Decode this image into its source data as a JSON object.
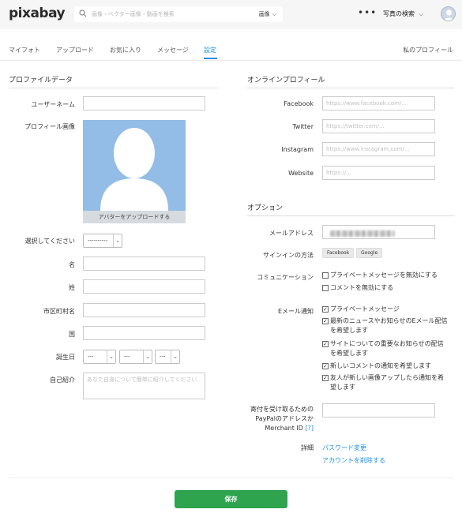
{
  "header": {
    "logo": "pixabay",
    "search_placeholder": "画像・ベクター画像・動画を検索",
    "search_type": "画像",
    "more": "•••",
    "explore": "写真の検索"
  },
  "tabs": {
    "items": [
      "マイフォト",
      "アップロード",
      "お気に入り",
      "メッセージ",
      "設定"
    ],
    "active": "設定",
    "my_profile": "私のプロフィール"
  },
  "profile": {
    "section_title": "プロファイルデータ",
    "username_label": "ユーザーネーム",
    "username_value": "",
    "image_label": "プロフィール画像",
    "upload_label": "アバターをアップロードする",
    "select_label": "選択してください",
    "select_value": "----------",
    "first_name_label": "名",
    "last_name_label": "姓",
    "city_label": "市区町村名",
    "country_label": "国",
    "birthday_label": "誕生日",
    "birthday_day": "---",
    "birthday_month": "---",
    "birthday_year": "---",
    "bio_label": "自己紹介",
    "bio_placeholder": "あなた自身について簡単に紹介してください"
  },
  "online": {
    "section_title": "オンラインプロフィール",
    "facebook_label": "Facebook",
    "facebook_placeholder": "https://www.facebook.com/...",
    "twitter_label": "Twitter",
    "twitter_placeholder": "https://twitter.com/...",
    "instagram_label": "Instagram",
    "instagram_placeholder": "https://www.instagram.com/...",
    "website_label": "Website",
    "website_placeholder": "https://..."
  },
  "options": {
    "section_title": "オプション",
    "email_label": "メールアドレス",
    "signin_label": "サインインの方法",
    "signin_methods": [
      "Facebook",
      "Google"
    ],
    "communication_label": "コミュニケーション",
    "communication_options": [
      {
        "label": "プライベートメッセージを無効にする",
        "checked": false
      },
      {
        "label": "コメントを無効にする",
        "checked": false
      }
    ],
    "email_notify_label": "Eメール通知",
    "email_notify_options": [
      {
        "label": "プライベートメッセージ",
        "checked": true
      },
      {
        "label": "最新のニュースやお知らせのEメール配信を希望します",
        "checked": true
      },
      {
        "label": "サイトについての重要なお知らせの配信を希望します",
        "checked": true
      },
      {
        "label": "新しいコメントの通知を希望します",
        "checked": true
      },
      {
        "label": "友人が新しい画像アップしたら通知を希望します",
        "checked": true
      }
    ],
    "paypal_label_line1": "寄付を受け取るための",
    "paypal_label_line2": "PayPalのアドレスか",
    "paypal_label_line3": "Merchant ID",
    "paypal_help": "[?]",
    "details_label": "詳細",
    "change_password": "パスワード変更",
    "delete_account": "アカウントを削除する"
  },
  "footer": {
    "save_label": "保存"
  },
  "colors": {
    "accent": "#1b8fe3",
    "save_green": "#2ea44f",
    "avatar_bg": "#93bde6"
  }
}
